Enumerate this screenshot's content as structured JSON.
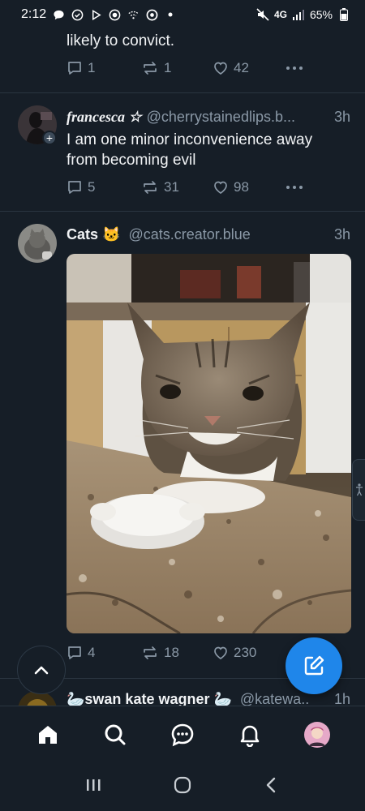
{
  "status_bar": {
    "time": "2:12",
    "network": "4G",
    "battery": "65%",
    "icons": [
      "chat-bubble-icon",
      "check-circle-icon",
      "play-icon",
      "record-icon",
      "wifi-off-icon",
      "target-icon",
      "dot-icon",
      "mute-icon",
      "signal-icon",
      "battery-icon"
    ]
  },
  "posts": [
    {
      "text": "likely to convict.",
      "replies": "1",
      "reposts": "1",
      "likes": "42"
    },
    {
      "display_name": "francesca ☆",
      "handle": "@cherrystainedlips.b...",
      "time": "3h",
      "text": "I am one minor inconvenience away from becoming evil",
      "replies": "5",
      "reposts": "31",
      "likes": "98"
    },
    {
      "display_name": "Cats 🐱",
      "handle": "@cats.creator.blue",
      "time": "3h",
      "image": "cat-drinking-milk-photo",
      "replies": "4",
      "reposts": "18",
      "likes": "230"
    },
    {
      "display_name": "🦢swan kate wagner 🦢",
      "handle": "@katewa..",
      "time": "1h"
    }
  ],
  "tabbar": [
    "home-icon",
    "search-icon",
    "chat-icon",
    "bell-icon",
    "profile-avatar"
  ],
  "colors": {
    "background": "#161e27",
    "accent": "#1f86ea",
    "muted": "#8a98a6"
  }
}
